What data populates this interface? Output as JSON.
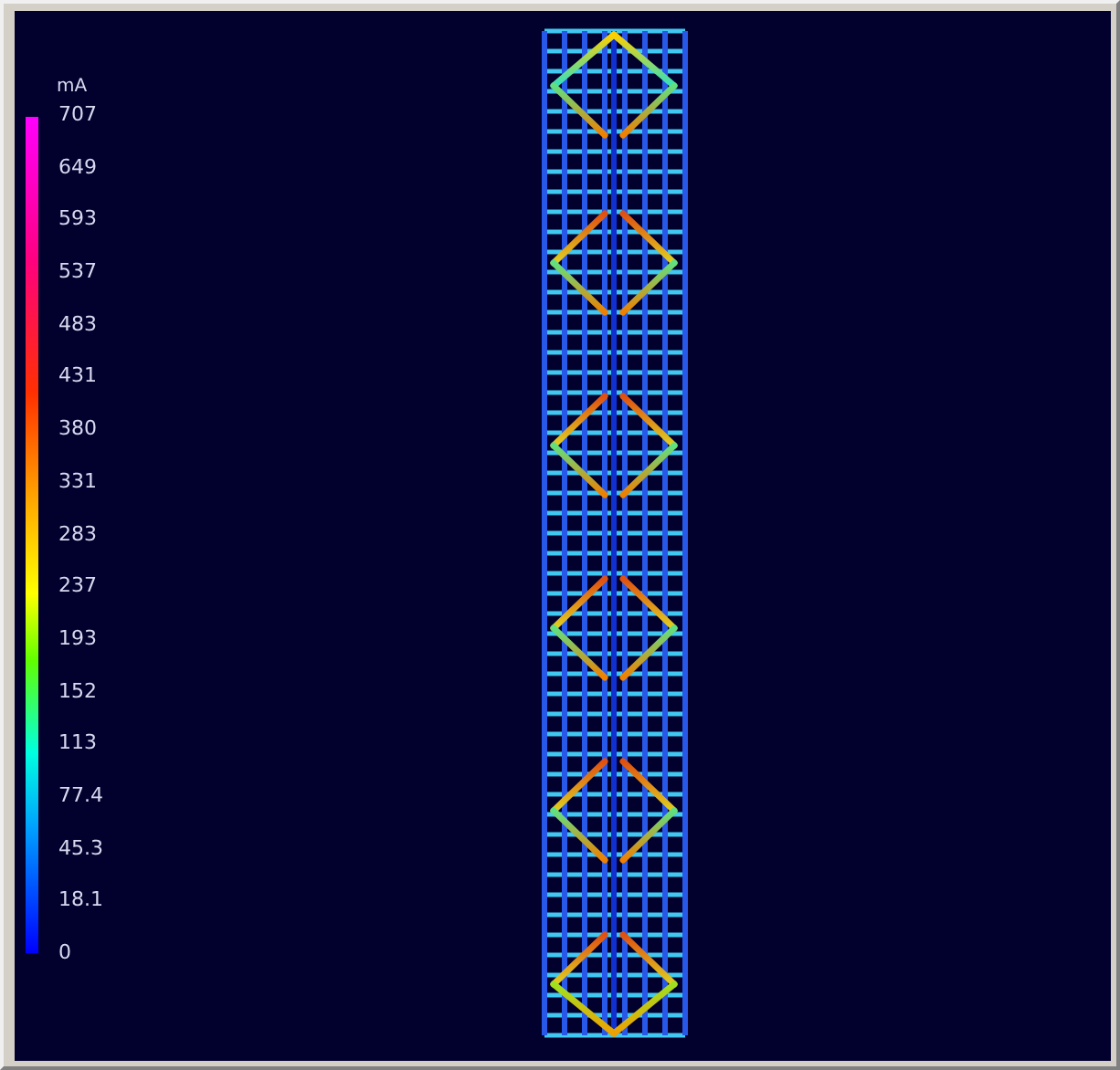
{
  "legend": {
    "unit": "mA",
    "ticks": [
      "707",
      "649",
      "593",
      "537",
      "483",
      "431",
      "380",
      "331",
      "283",
      "237",
      "193",
      "152",
      "113",
      "77.4",
      "45.3",
      "18.1",
      "0"
    ]
  }
}
